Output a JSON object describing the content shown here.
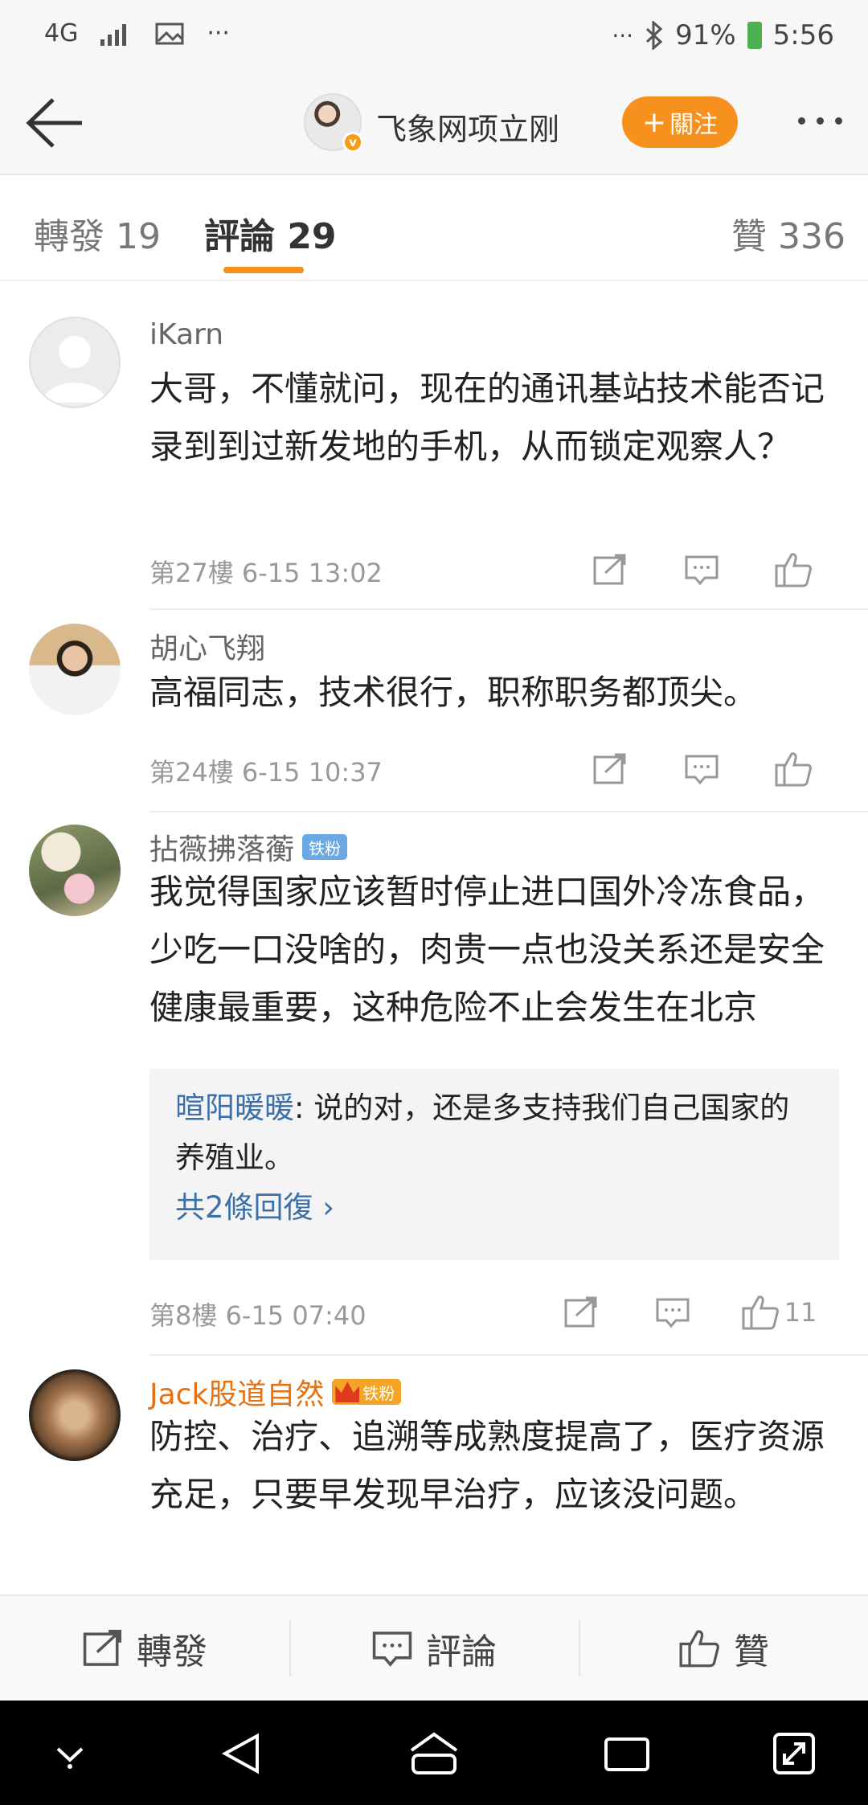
{
  "status_bar": {
    "network": "4G",
    "battery": "91%",
    "time": "5:56",
    "more_left": "···",
    "more_right": "···"
  },
  "header": {
    "title": "飞象网项立刚",
    "follow_label": "關注",
    "verified_mark": "v"
  },
  "tabs": [
    {
      "label": "轉發 19"
    },
    {
      "label": "評論 29"
    },
    {
      "label": "贊 336"
    }
  ],
  "comments": [
    {
      "author": "iKarn",
      "text": "大哥，不懂就问，现在的通讯基站技术能否记录到到过新发地的手机，从而锁定观察人？",
      "meta": "第27樓  6-15 13:02"
    },
    {
      "author": "胡心飞翔",
      "text": "高福同志，技术很行，职称职务都顶尖。",
      "meta": "第24樓  6-15 10:37"
    },
    {
      "author": "拈薇拂落蘅",
      "badge": "铁粉",
      "text": "我觉得国家应该暂时停止进口国外冷冻食品，少吃一口没啥的，肉贵一点也没关系还是安全健康最重要，这种危险不止会发生在北京",
      "reply": {
        "user": "暄阳暖暖",
        "text": ": 说的对，还是多支持我们自己国家的养殖业。",
        "more": "共2條回復 ›"
      },
      "meta": "第8樓  6-15 07:40",
      "likes": "11"
    },
    {
      "author": "Jack股道自然",
      "badge": "铁粉",
      "text": "防控、治疗、追溯等成熟度提高了，医疗资源充足，只要早发现早治疗，应该没问题。"
    }
  ],
  "bottom_bar": {
    "repost": "轉發",
    "comment": "評論",
    "like": "贊"
  }
}
